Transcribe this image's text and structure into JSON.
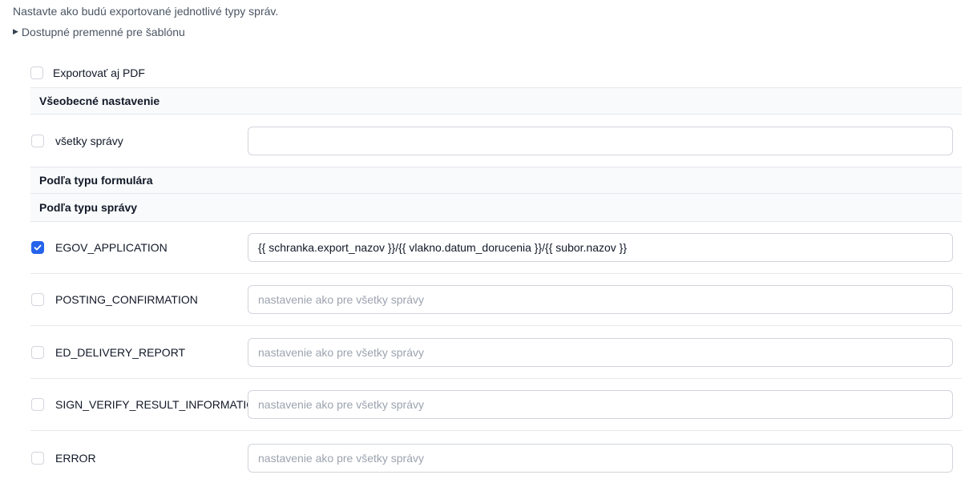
{
  "intro_text": "Nastavte ako budú exportované jednotlivé typy správ.",
  "template_vars_label": "Dostupné premenné pre šablónu",
  "export_pdf": {
    "label": "Exportovať aj PDF",
    "checked": false
  },
  "general": {
    "header": "Všeobecné nastavenie",
    "all_messages": {
      "label": "všetky správy",
      "value": "",
      "checked": false
    }
  },
  "by_form_type_header": "Podľa typu formulára",
  "by_message_type_header": "Podľa typu správy",
  "placeholder": "nastavenie ako pre všetky správy",
  "message_types": [
    {
      "label": "EGOV_APPLICATION",
      "checked": true,
      "value": "{{ schranka.export_nazov }}/{{ vlakno.datum_dorucenia }}/{{ subor.nazov }}"
    },
    {
      "label": "POSTING_CONFIRMATION",
      "checked": false,
      "value": ""
    },
    {
      "label": "ED_DELIVERY_REPORT",
      "checked": false,
      "value": ""
    },
    {
      "label": "SIGN_VERIFY_RESULT_INFORMATION",
      "checked": false,
      "value": ""
    },
    {
      "label": "ERROR",
      "checked": false,
      "value": ""
    }
  ],
  "colors": {
    "accent": "#2563eb",
    "border": "#e5e7eb",
    "section_bg": "#f9fafb"
  }
}
